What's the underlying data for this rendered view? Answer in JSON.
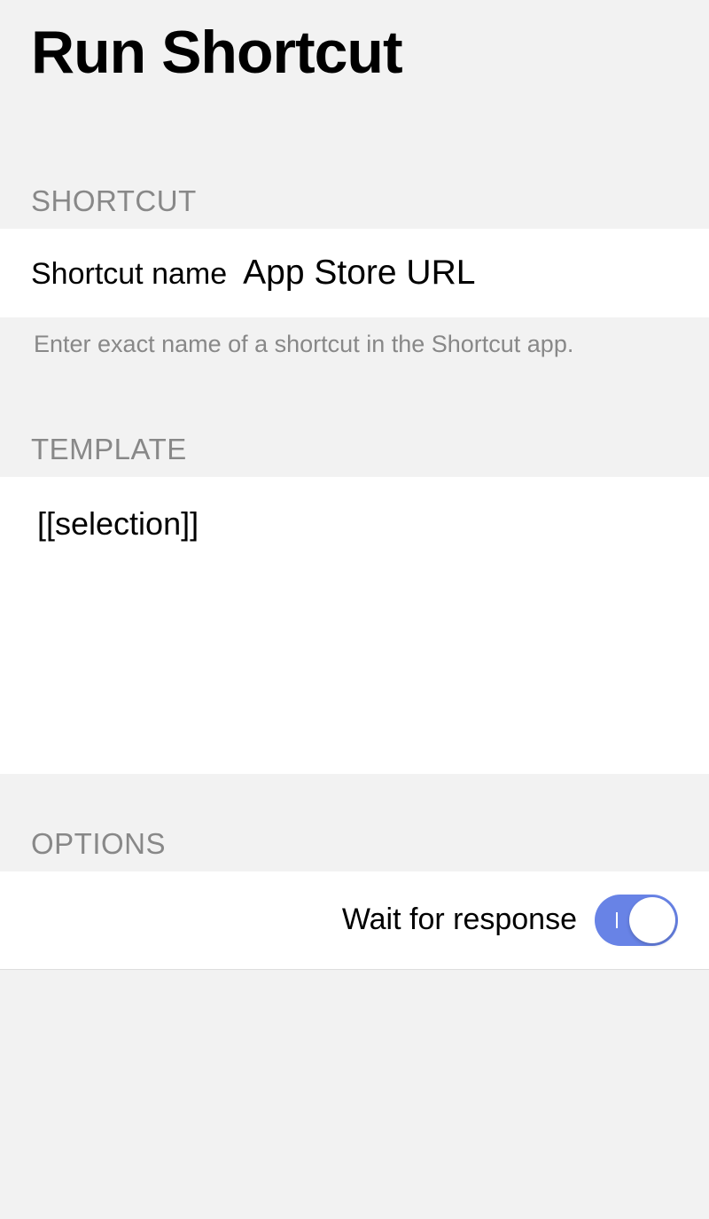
{
  "page": {
    "title": "Run Shortcut"
  },
  "sections": {
    "shortcut": {
      "header": "SHORTCUT",
      "name_label": "Shortcut name",
      "name_value": "App Store URL",
      "footer": "Enter exact name of a shortcut in the Shortcut app."
    },
    "template": {
      "header": "TEMPLATE",
      "value": "[[selection]]"
    },
    "options": {
      "header": "OPTIONS",
      "wait_label": "Wait for response",
      "wait_value": true
    }
  }
}
